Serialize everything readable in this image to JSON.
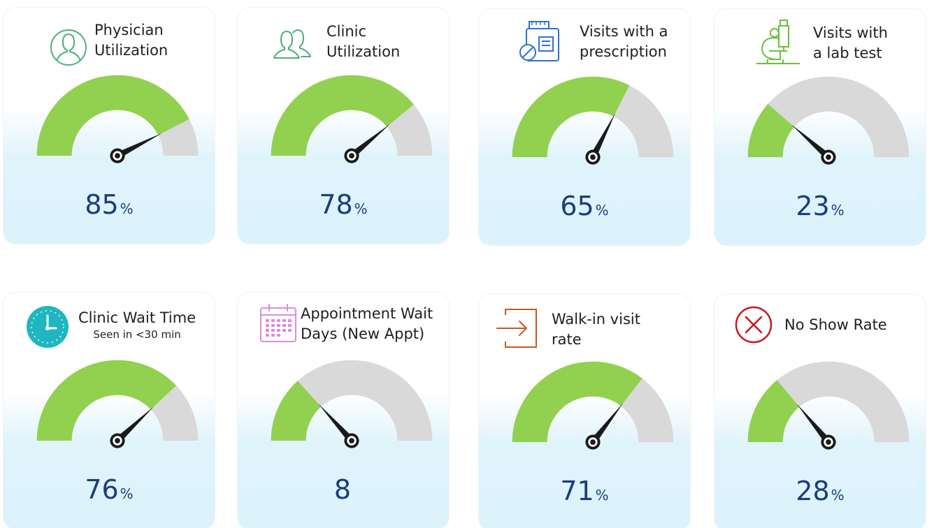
{
  "colors": {
    "filled": "#92d050",
    "empty": "#d9d9d9",
    "needle": "#1a1a1a",
    "value_text": "#1c3d7a"
  },
  "chart_data": [
    {
      "type": "gauge",
      "title": [
        "Physician",
        "Utilization"
      ],
      "value": 85,
      "unit": "%",
      "range": [
        0,
        100
      ],
      "icon": "person-icon",
      "icon_color": "#4caf7a"
    },
    {
      "type": "gauge",
      "title": [
        "Clinic",
        "Utilization"
      ],
      "value": 78,
      "unit": "%",
      "range": [
        0,
        100
      ],
      "icon": "group-icon",
      "icon_color": "#4caf7a"
    },
    {
      "type": "gauge",
      "title": [
        "Visits with a",
        "prescription"
      ],
      "value": 65,
      "unit": "%",
      "range": [
        0,
        100
      ],
      "icon": "prescription-icon",
      "icon_color": "#2f6fd6"
    },
    {
      "type": "gauge",
      "title": [
        "Visits with",
        "a lab test"
      ],
      "value": 23,
      "unit": "%",
      "range": [
        0,
        100
      ],
      "icon": "microscope-icon",
      "icon_color": "#6abf3a"
    },
    {
      "type": "gauge",
      "title": [
        "Clinic Wait Time"
      ],
      "subtitle": "Seen in <30 min",
      "value": 76,
      "unit": "%",
      "range": [
        0,
        100
      ],
      "icon": "clock-icon",
      "icon_color": "#1fb6c1"
    },
    {
      "type": "gauge",
      "title": [
        "Appointment Wait",
        "Days (New Appt)"
      ],
      "value": 8,
      "unit": "",
      "range": [
        0,
        30
      ],
      "icon": "calendar-icon",
      "icon_color": "#d98ce0"
    },
    {
      "type": "gauge",
      "title": [
        "Walk-in visit",
        "rate"
      ],
      "value": 71,
      "unit": "%",
      "range": [
        0,
        100
      ],
      "icon": "walk-in-icon",
      "icon_color": "#c65a1e"
    },
    {
      "type": "gauge",
      "title": [
        "No Show Rate"
      ],
      "value": 28,
      "unit": "%",
      "range": [
        0,
        100
      ],
      "icon": "no-show-icon",
      "icon_color": "#c8161d"
    }
  ]
}
